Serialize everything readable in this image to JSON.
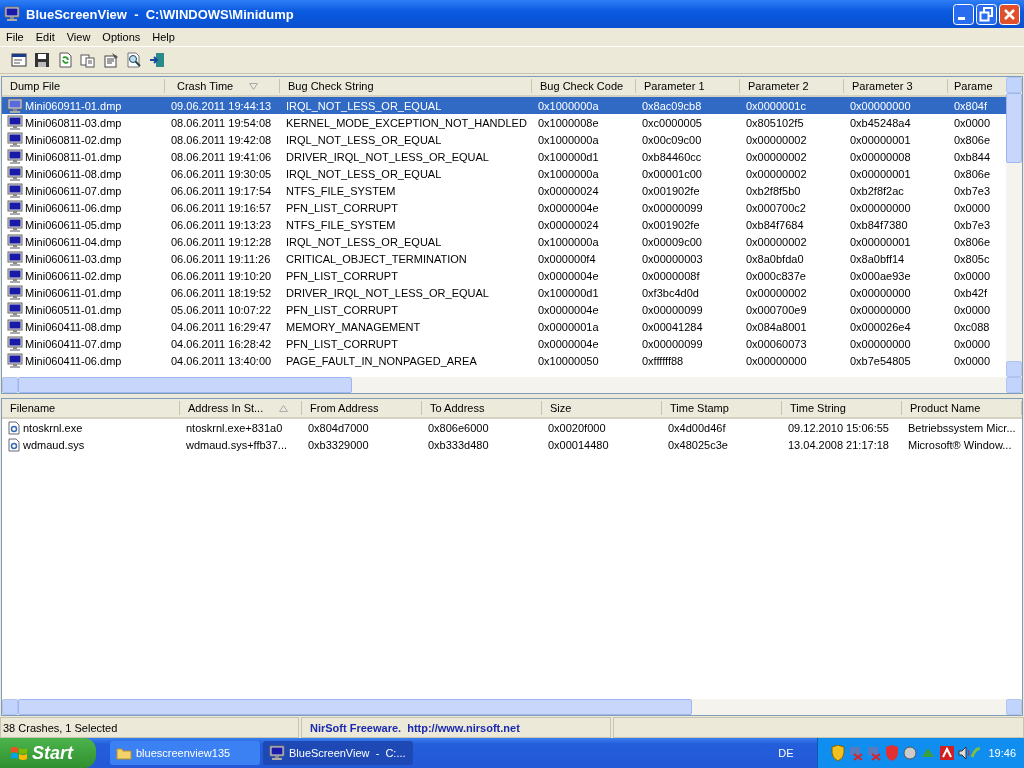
{
  "window": {
    "title": "BlueScreenView  -  C:\\WINDOWS\\Minidump"
  },
  "menu": [
    "File",
    "Edit",
    "View",
    "Options",
    "Help"
  ],
  "crash_list": {
    "columns": [
      {
        "label": "Dump File",
        "kind": "plain"
      },
      {
        "label": "Crash Time",
        "kind": "descending"
      },
      {
        "label": "Bug Check String",
        "kind": "plain"
      },
      {
        "label": "Bug Check Code",
        "kind": "plain"
      },
      {
        "label": "Parameter 1",
        "kind": "plain"
      },
      {
        "label": "Parameter 2",
        "kind": "plain"
      },
      {
        "label": "Parameter 3",
        "kind": "plain"
      },
      {
        "label": "Parame",
        "kind": "plain"
      }
    ],
    "rows": [
      {
        "selected": true,
        "cells": [
          "Mini060911-01.dmp",
          "09.06.2011 19:44:13",
          "IRQL_NOT_LESS_OR_EQUAL",
          "0x1000000a",
          "0x8ac09cb8",
          "0x0000001c",
          "0x00000000",
          "0x804f"
        ]
      },
      {
        "selected": false,
        "cells": [
          "Mini060811-03.dmp",
          "08.06.2011 19:54:08",
          "KERNEL_MODE_EXCEPTION_NOT_HANDLED",
          "0x1000008e",
          "0xc0000005",
          "0x805102f5",
          "0xb45248a4",
          "0x0000"
        ]
      },
      {
        "selected": false,
        "cells": [
          "Mini060811-02.dmp",
          "08.06.2011 19:42:08",
          "IRQL_NOT_LESS_OR_EQUAL",
          "0x1000000a",
          "0x00c09c00",
          "0x00000002",
          "0x00000001",
          "0x806e"
        ]
      },
      {
        "selected": false,
        "cells": [
          "Mini060811-01.dmp",
          "08.06.2011 19:41:06",
          "DRIVER_IRQL_NOT_LESS_OR_EQUAL",
          "0x100000d1",
          "0xb84460cc",
          "0x00000002",
          "0x00000008",
          "0xb844"
        ]
      },
      {
        "selected": false,
        "cells": [
          "Mini060611-08.dmp",
          "06.06.2011 19:30:05",
          "IRQL_NOT_LESS_OR_EQUAL",
          "0x1000000a",
          "0x00001c00",
          "0x00000002",
          "0x00000001",
          "0x806e"
        ]
      },
      {
        "selected": false,
        "cells": [
          "Mini060611-07.dmp",
          "06.06.2011 19:17:54",
          "NTFS_FILE_SYSTEM",
          "0x00000024",
          "0x001902fe",
          "0xb2f8f5b0",
          "0xb2f8f2ac",
          "0xb7e3"
        ]
      },
      {
        "selected": false,
        "cells": [
          "Mini060611-06.dmp",
          "06.06.2011 19:16:57",
          "PFN_LIST_CORRUPT",
          "0x0000004e",
          "0x00000099",
          "0x000700c2",
          "0x00000000",
          "0x0000"
        ]
      },
      {
        "selected": false,
        "cells": [
          "Mini060611-05.dmp",
          "06.06.2011 19:13:23",
          "NTFS_FILE_SYSTEM",
          "0x00000024",
          "0x001902fe",
          "0xb84f7684",
          "0xb84f7380",
          "0xb7e3"
        ]
      },
      {
        "selected": false,
        "cells": [
          "Mini060611-04.dmp",
          "06.06.2011 19:12:28",
          "IRQL_NOT_LESS_OR_EQUAL",
          "0x1000000a",
          "0x00009c00",
          "0x00000002",
          "0x00000001",
          "0x806e"
        ]
      },
      {
        "selected": false,
        "cells": [
          "Mini060611-03.dmp",
          "06.06.2011 19:11:26",
          "CRITICAL_OBJECT_TERMINATION",
          "0x000000f4",
          "0x00000003",
          "0x8a0bfda0",
          "0x8a0bff14",
          "0x805c"
        ]
      },
      {
        "selected": false,
        "cells": [
          "Mini060611-02.dmp",
          "06.06.2011 19:10:20",
          "PFN_LIST_CORRUPT",
          "0x0000004e",
          "0x0000008f",
          "0x000c837e",
          "0x000ae93e",
          "0x0000"
        ]
      },
      {
        "selected": false,
        "cells": [
          "Mini060611-01.dmp",
          "06.06.2011 18:19:52",
          "DRIVER_IRQL_NOT_LESS_OR_EQUAL",
          "0x100000d1",
          "0xf3bc4d0d",
          "0x00000002",
          "0x00000000",
          "0xb42f"
        ]
      },
      {
        "selected": false,
        "cells": [
          "Mini060511-01.dmp",
          "05.06.2011 10:07:22",
          "PFN_LIST_CORRUPT",
          "0x0000004e",
          "0x00000099",
          "0x000700e9",
          "0x00000000",
          "0x0000"
        ]
      },
      {
        "selected": false,
        "cells": [
          "Mini060411-08.dmp",
          "04.06.2011 16:29:47",
          "MEMORY_MANAGEMENT",
          "0x0000001a",
          "0x00041284",
          "0x084a8001",
          "0x000026e4",
          "0xc088"
        ]
      },
      {
        "selected": false,
        "cells": [
          "Mini060411-07.dmp",
          "04.06.2011 16:28:42",
          "PFN_LIST_CORRUPT",
          "0x0000004e",
          "0x00000099",
          "0x00060073",
          "0x00000000",
          "0x0000"
        ]
      },
      {
        "selected": false,
        "cells": [
          "Mini060411-06.dmp",
          "04.06.2011 13:40:00",
          "PAGE_FAULT_IN_NONPAGED_AREA",
          "0x10000050",
          "0xffffff88",
          "0x00000000",
          "0xb7e54805",
          "0x0000"
        ]
      }
    ]
  },
  "driver_list": {
    "columns": [
      {
        "label": "Filename",
        "kind": "plain"
      },
      {
        "label": "Address In St...",
        "kind": "ascending"
      },
      {
        "label": "From Address",
        "kind": "plain"
      },
      {
        "label": "To Address",
        "kind": "plain"
      },
      {
        "label": "Size",
        "kind": "plain"
      },
      {
        "label": "Time Stamp",
        "kind": "plain"
      },
      {
        "label": "Time String",
        "kind": "plain"
      },
      {
        "label": "Product Name",
        "kind": "plain"
      }
    ],
    "rows": [
      {
        "selected": false,
        "cells": [
          "ntoskrnl.exe",
          "ntoskrnl.exe+831a0",
          "0x804d7000",
          "0x806e6000",
          "0x0020f000",
          "0x4d00d46f",
          "09.12.2010 15:06:55",
          "Betriebssystem Micr..."
        ]
      },
      {
        "selected": false,
        "cells": [
          "wdmaud.sys",
          "wdmaud.sys+ffb37...",
          "0xb3329000",
          "0xb333d480",
          "0x00014480",
          "0x48025c3e",
          "13.04.2008 21:17:18",
          "Microsoft® Window..."
        ]
      }
    ]
  },
  "status_bar": {
    "count": "38 Crashes, 1 Selected",
    "credit": "NirSoft Freeware.  http://www.nirsoft.net"
  },
  "taskbar": {
    "start": "Start",
    "tasks": [
      {
        "label": "bluescreenview135",
        "selected": false,
        "kind": "folder"
      },
      {
        "label": "BlueScreenView  -  C:...",
        "selected": true,
        "kind": "app"
      }
    ],
    "language": "DE",
    "clock": "19:46"
  }
}
